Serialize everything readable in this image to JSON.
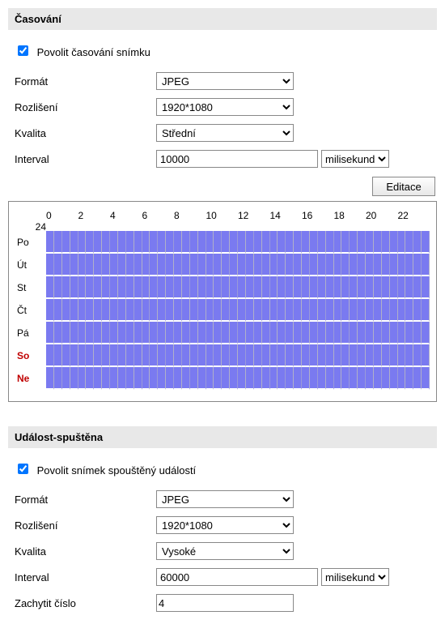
{
  "timing": {
    "header": "Časování",
    "enable_label": "Povolit časování snímku",
    "enable_checked": true,
    "format_label": "Formát",
    "format_value": "JPEG",
    "resolution_label": "Rozlišení",
    "resolution_value": "1920*1080",
    "quality_label": "Kvalita",
    "quality_value": "Střední",
    "interval_label": "Interval",
    "interval_value": "10000",
    "interval_unit": "milisekund",
    "edit_button": "Editace"
  },
  "schedule": {
    "hours": [
      "0",
      "2",
      "4",
      "6",
      "8",
      "10",
      "12",
      "14",
      "16",
      "18",
      "20",
      "22",
      "24"
    ],
    "days": [
      {
        "label": "Po",
        "weekend": false
      },
      {
        "label": "Út",
        "weekend": false
      },
      {
        "label": "St",
        "weekend": false
      },
      {
        "label": "Čt",
        "weekend": false
      },
      {
        "label": "Pá",
        "weekend": false
      },
      {
        "label": "So",
        "weekend": true
      },
      {
        "label": "Ne",
        "weekend": true
      }
    ]
  },
  "event": {
    "header": "Událost-spuštěna",
    "enable_label": "Povolit snímek spouštěný událostí",
    "enable_checked": true,
    "format_label": "Formát",
    "format_value": "JPEG",
    "resolution_label": "Rozlišení",
    "resolution_value": "1920*1080",
    "quality_label": "Kvalita",
    "quality_value": "Vysoké",
    "interval_label": "Interval",
    "interval_value": "60000",
    "interval_unit": "milisekund",
    "capture_label": "Zachytit číslo",
    "capture_value": "4"
  }
}
